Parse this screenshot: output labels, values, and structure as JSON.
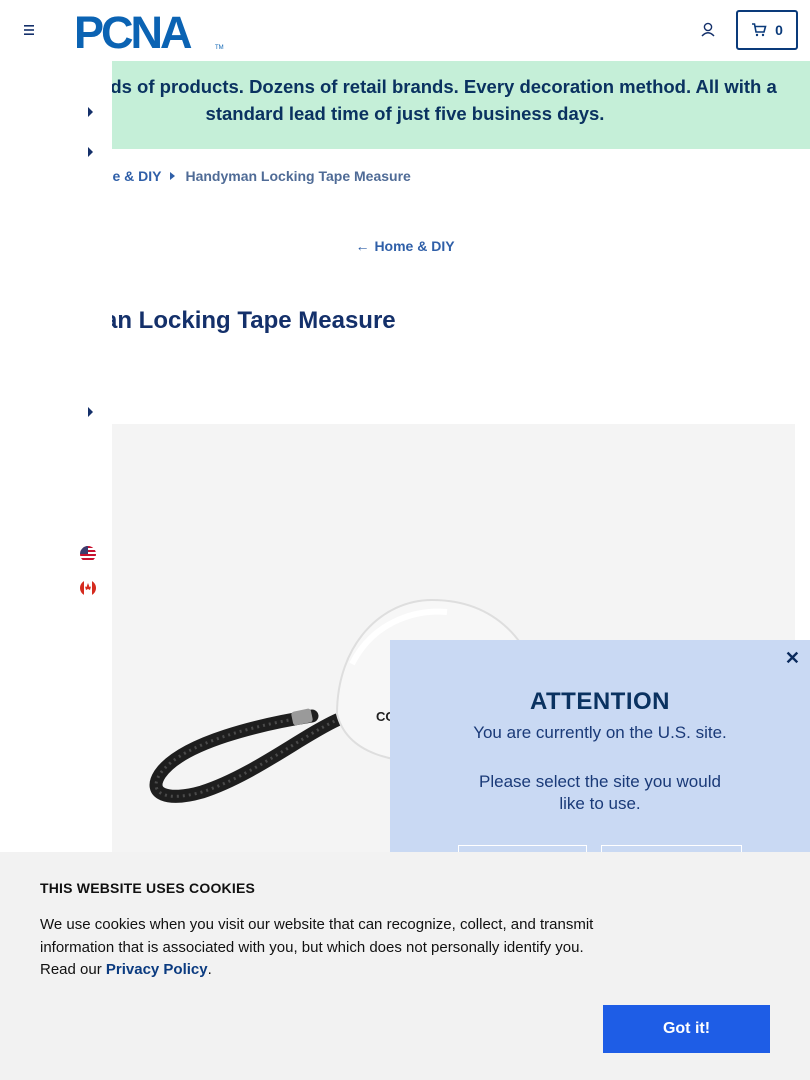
{
  "header": {
    "logo_text": "PCNA",
    "cart_count": "0",
    "icons": {
      "menu": "hamburger-icon",
      "account": "user-icon",
      "cart": "cart-icon"
    }
  },
  "promo": {
    "text": "Thousands of products. Dozens of retail brands. Every decoration method. All with a standard lead time of just five business days."
  },
  "breadcrumb": {
    "parent_label": "me & DIY",
    "current_label": "Handyman Locking Tape Measure"
  },
  "back_link": {
    "label": "Home & DIY"
  },
  "product": {
    "title_visible": "an Locking Tape Measure",
    "imprint_text": "CO"
  },
  "side_drawer": {
    "flags": [
      "us-flag-icon",
      "canada-flag-icon"
    ]
  },
  "attention": {
    "title": "ATTENTION",
    "line1": "You are currently on the U.S. site.",
    "line2": "Please select the site you would like to use."
  },
  "cookies": {
    "title": "THIS WEBSITE USES COOKIES",
    "body": "We use cookies when you visit our website that can recognize, collect, and transmit information that is associated with you, but which does not personally identify you. Read our ",
    "policy_link": "Privacy Policy",
    "period": ".",
    "button": "Got it!"
  },
  "colors": {
    "promo_bg": "#c5efd8",
    "brand_navy": "#0a3a7a",
    "link_blue": "#2f5fa8",
    "modal_bg": "#c9d9f3",
    "cookie_btn": "#1e5de6"
  }
}
